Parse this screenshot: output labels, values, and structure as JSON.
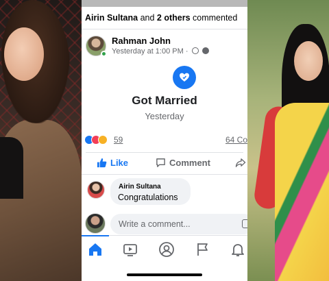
{
  "activity": {
    "actor": "Airin Sultana",
    "connector": " and ",
    "others": "2 others",
    "verb": " commented"
  },
  "post": {
    "author": "Rahman John",
    "time": "Yesterday at 1:00 PM",
    "time_separator": " · ",
    "event_icon": "heart-icon",
    "event_title": "Got Married",
    "event_subtitle": "Yesterday"
  },
  "stats": {
    "reaction_count": "59",
    "comment_count": "64 Co",
    "reaction_icons": [
      "like-icon",
      "love-icon",
      "wow-icon"
    ]
  },
  "actions": {
    "like_label": "Like",
    "comment_label": "Comment"
  },
  "comment": {
    "author": "Airin Sultana",
    "text": "Congratulations"
  },
  "composer": {
    "placeholder": "Write a comment..."
  },
  "tabs": [
    "home-icon",
    "watch-icon",
    "profile-icon",
    "pages-flag-icon",
    "notifications-bell-icon"
  ],
  "colors": {
    "accent": "#1877f2",
    "online": "#31a24c",
    "love": "#f33e58",
    "wow": "#f7b125"
  }
}
